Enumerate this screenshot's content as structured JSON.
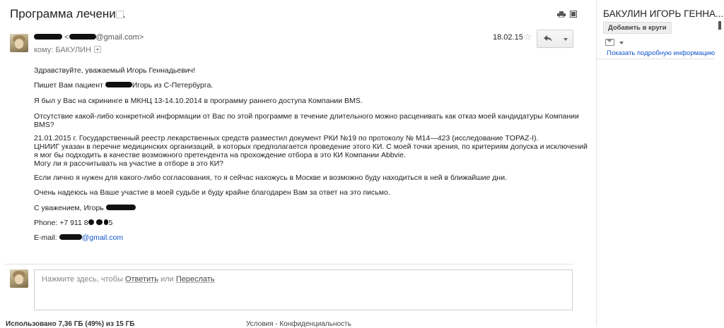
{
  "subject": "Программа лечения.",
  "sender": {
    "email_suffix": "@gmail.com>",
    "to_label": "кому: БАКУЛИН",
    "date": "18.02.15"
  },
  "toolbar": {
    "star": "☆",
    "reply_icon": "reply-icon"
  },
  "body": {
    "greeting": "Здравствуйте, уважаемый Игорь Геннадьевич!",
    "p1_before": "Пишет Вам пациент",
    "p1_after": "Игорь из С-Петербурга.",
    "p2": "Я был у Вас на скрининге в МКНЦ 13-14.10.2014 в программу раннего  доступа Компании BMS.",
    "p3_line1": "Отсутствие какой-либо конкретной информации от Вас по этой программе  в течение длительного можно расценивать как отказ моей кандидатуры Компании",
    "p3_line2": "BMS?",
    "p4_line1": "21.01.2015 г. Государственный реестр лекарственных средств разместил документ РКИ №19 по протоколу № М14—423 (исследование TOPAZ-I).",
    "p4_line2": "ЦНИИГ указан в перечне медицинских организаций, в которых предполагается проведение этого КИ. С моей точки зрения, по критериям допуска и исключений",
    "p4_line3": "я мог бы подходить в качестве возможного претендента на прохождение отбора в это КИ Компании Abbvie.",
    "p4_line4": "Могу ли я рассчитывать на участие в отборе в это КИ?",
    "p5": "Если лично я нужен для какого-либо согласования, то я сейчас нахожусь в Москве и возможно буду находиться в ней  в ближайшие дни.",
    "p6": "Очень надеюсь на Ваше участие в моей судьбе и буду крайне благодарен Вам за ответ на это письмо.",
    "sign": "С уважением, Игорь",
    "phone_prefix": "Phone: +7 911 8",
    "phone_suffix": "5",
    "email_label": "E-mail:",
    "email_suffix": "@gmail.com"
  },
  "reply": {
    "hint_prefix": "Нажмите здесь, чтобы",
    "reply_link": "Ответить",
    "or": "или",
    "forward_link": "Переслать"
  },
  "footer": {
    "storage": "Использовано 7,36 ГБ (49%) из 15 ГБ",
    "storage_percent": 49,
    "terms": "Условия - Конфиденциальность"
  },
  "right_panel": {
    "name": "БАКУЛИН ИГОРЬ ГЕННА...",
    "add_circles": "Добавить в круги",
    "details_link": "Показать подробную информацию"
  }
}
